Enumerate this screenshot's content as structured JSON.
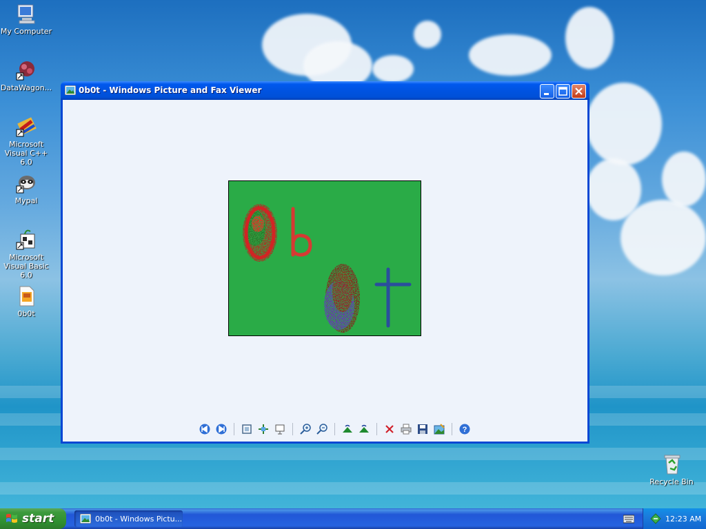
{
  "desktop": {
    "icons": [
      {
        "label": "My Computer"
      },
      {
        "label": "DataWagon..."
      },
      {
        "label": "Microsoft Visual C++ 6.0"
      },
      {
        "label": "Mypal"
      },
      {
        "label": "Microsoft Visual Basic 6.0"
      },
      {
        "label": "0b0t"
      },
      {
        "label": "Recycle Bin"
      }
    ]
  },
  "window": {
    "title": "0b0t - Windows Picture and Fax Viewer",
    "controls": [
      "minimize-icon",
      "maximize-icon",
      "close-icon"
    ],
    "toolbar": [
      "previous-image-icon",
      "next-image-icon",
      "best-fit-icon",
      "actual-size-icon",
      "slideshow-icon",
      "zoom-in-icon",
      "zoom-out-icon",
      "rotate-clockwise-icon",
      "rotate-counterclockwise-icon",
      "delete-icon",
      "print-icon",
      "save-icon",
      "edit-icon",
      "help-icon"
    ]
  },
  "taskbar": {
    "start_label": "start",
    "task_label": "0b0t - Windows Pictu...",
    "clock": "12:23 AM"
  },
  "colors": {
    "title_blue": "#0058ee",
    "image_green": "#2aab47",
    "start_green": "#3c9a3c"
  }
}
